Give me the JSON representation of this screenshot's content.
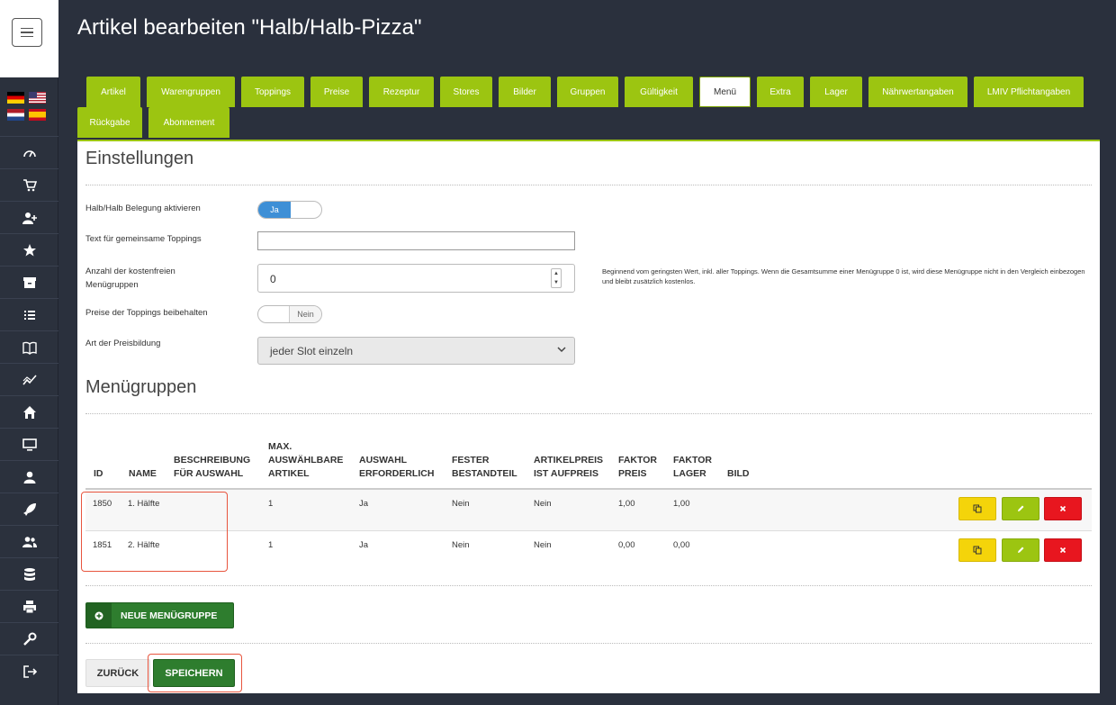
{
  "page": {
    "title": "Artikel bearbeiten \"Halb/Halb-Pizza\""
  },
  "sidebar": {
    "menu_icon": "hamburger-icon",
    "flags": [
      "de",
      "us",
      "nl",
      "es"
    ],
    "icons": [
      "dashboard-icon",
      "cart-icon",
      "user-plus-icon",
      "star-icon",
      "archive-icon",
      "list-icon",
      "book-icon",
      "chart-line-icon",
      "home-icon",
      "monitor-icon",
      "user-icon",
      "rocket-icon",
      "users-icon",
      "database-icon",
      "printer-icon",
      "wrench-icon",
      "logout-icon"
    ]
  },
  "tabs": [
    {
      "label": "Artikel"
    },
    {
      "label": "Warengruppen"
    },
    {
      "label": "Toppings"
    },
    {
      "label": "Preise"
    },
    {
      "label": "Rezeptur"
    },
    {
      "label": "Stores"
    },
    {
      "label": "Bilder"
    },
    {
      "label": "Gruppen"
    },
    {
      "label": "Gültigkeit"
    },
    {
      "label": "Menü"
    },
    {
      "label": "Extra"
    },
    {
      "label": "Lager"
    },
    {
      "label": "Nährwertangaben"
    },
    {
      "label": "LMIV Pflichtangaben"
    },
    {
      "label": "Rückgabe"
    },
    {
      "label": "Abonnement"
    }
  ],
  "active_tab": "Menü",
  "settings": {
    "title": "Einstellungen",
    "halfhalf_label": "Halb/Halb Belegung aktivieren",
    "halfhalf_on": "Ja",
    "common_text_label": "Text für gemeinsame Toppings",
    "common_text_value": "",
    "free_groups_label": "Anzahl der kostenfreien Menügruppen",
    "free_groups_value": "0",
    "free_groups_hint": "Beginnend vom geringsten Wert, inkl. aller Toppings. Wenn die Gesamtsumme einer Menügruppe 0 ist, wird diese Menügruppe nicht in den Vergleich einbezogen und bleibt zusätzlich kostenlos.",
    "keep_prices_label": "Preise der Toppings beibehalten",
    "keep_prices_off": "Nein",
    "pricing_label": "Art der Preisbildung",
    "pricing_value": "jeder Slot einzeln"
  },
  "groups": {
    "title": "Menügruppen",
    "headers": {
      "id": "ID",
      "name": "NAME",
      "desc": "BESCHREIBUNG FÜR AUSWAHL",
      "max": "MAX. AUSWÄHLBARE ARTIKEL",
      "required": "AUSWAHL ERFORDERLICH",
      "fixed": "FESTER BESTANDTEIL",
      "surcharge": "ARTIKELPREIS IST AUFPREIS",
      "factor_price": "FAKTOR PREIS",
      "factor_stock": "FAKTOR LAGER",
      "image": "BILD"
    },
    "rows": [
      {
        "id": "1850",
        "name": "1. Hälfte",
        "desc": "",
        "max": "1",
        "required": "Ja",
        "fixed": "Nein",
        "surcharge": "Nein",
        "factor_price": "1,00",
        "factor_stock": "1,00"
      },
      {
        "id": "1851",
        "name": "2. Hälfte",
        "desc": "",
        "max": "1",
        "required": "Ja",
        "fixed": "Nein",
        "surcharge": "Nein",
        "factor_price": "0,00",
        "factor_stock": "0,00"
      }
    ],
    "new_button": "NEUE MENÜGRUPPE"
  },
  "footer": {
    "back": "ZURÜCK",
    "save": "SPEICHERN"
  },
  "colors": {
    "accent": "#9cc511",
    "primary_dark": "#2e7d2e",
    "sidebar": "#2b313d",
    "highlight": "#e8553e"
  }
}
